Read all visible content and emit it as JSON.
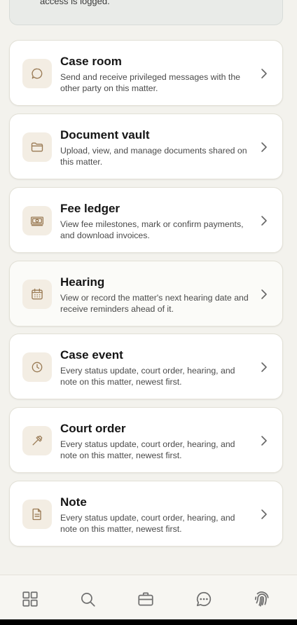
{
  "notice": {
    "text": "access is logged."
  },
  "cards": [
    {
      "title": "Case room",
      "description": "Send and receive privileged messages with the other party on this matter.",
      "icon": "chat-bubble-icon"
    },
    {
      "title": "Document vault",
      "description": "Upload, view, and manage documents shared on this matter.",
      "icon": "folder-icon"
    },
    {
      "title": "Fee ledger",
      "description": "View fee milestones, mark or confirm payments, and download invoices.",
      "icon": "banknote-icon"
    },
    {
      "title": "Hearing",
      "description": "View or record the matter's next hearing date and receive reminders ahead of it.",
      "icon": "calendar-icon"
    },
    {
      "title": "Case event",
      "description": "Every status update, court order, hearing, and note on this matter, newest first.",
      "icon": "clock-icon"
    },
    {
      "title": "Court order",
      "description": "Every status update, court order, hearing, and note on this matter, newest first.",
      "icon": "gavel-icon"
    },
    {
      "title": "Note",
      "description": "Every status update, court order, hearing, and note on this matter, newest first.",
      "icon": "note-icon"
    }
  ],
  "bottom_nav": [
    {
      "icon": "grid-icon"
    },
    {
      "icon": "search-icon"
    },
    {
      "icon": "briefcase-icon"
    },
    {
      "icon": "chat-icon"
    },
    {
      "icon": "fingerprint-icon"
    }
  ],
  "colors": {
    "background": "#f3f2ed",
    "accent": "#9a7b55",
    "icon_bg": "#f3ede3"
  }
}
